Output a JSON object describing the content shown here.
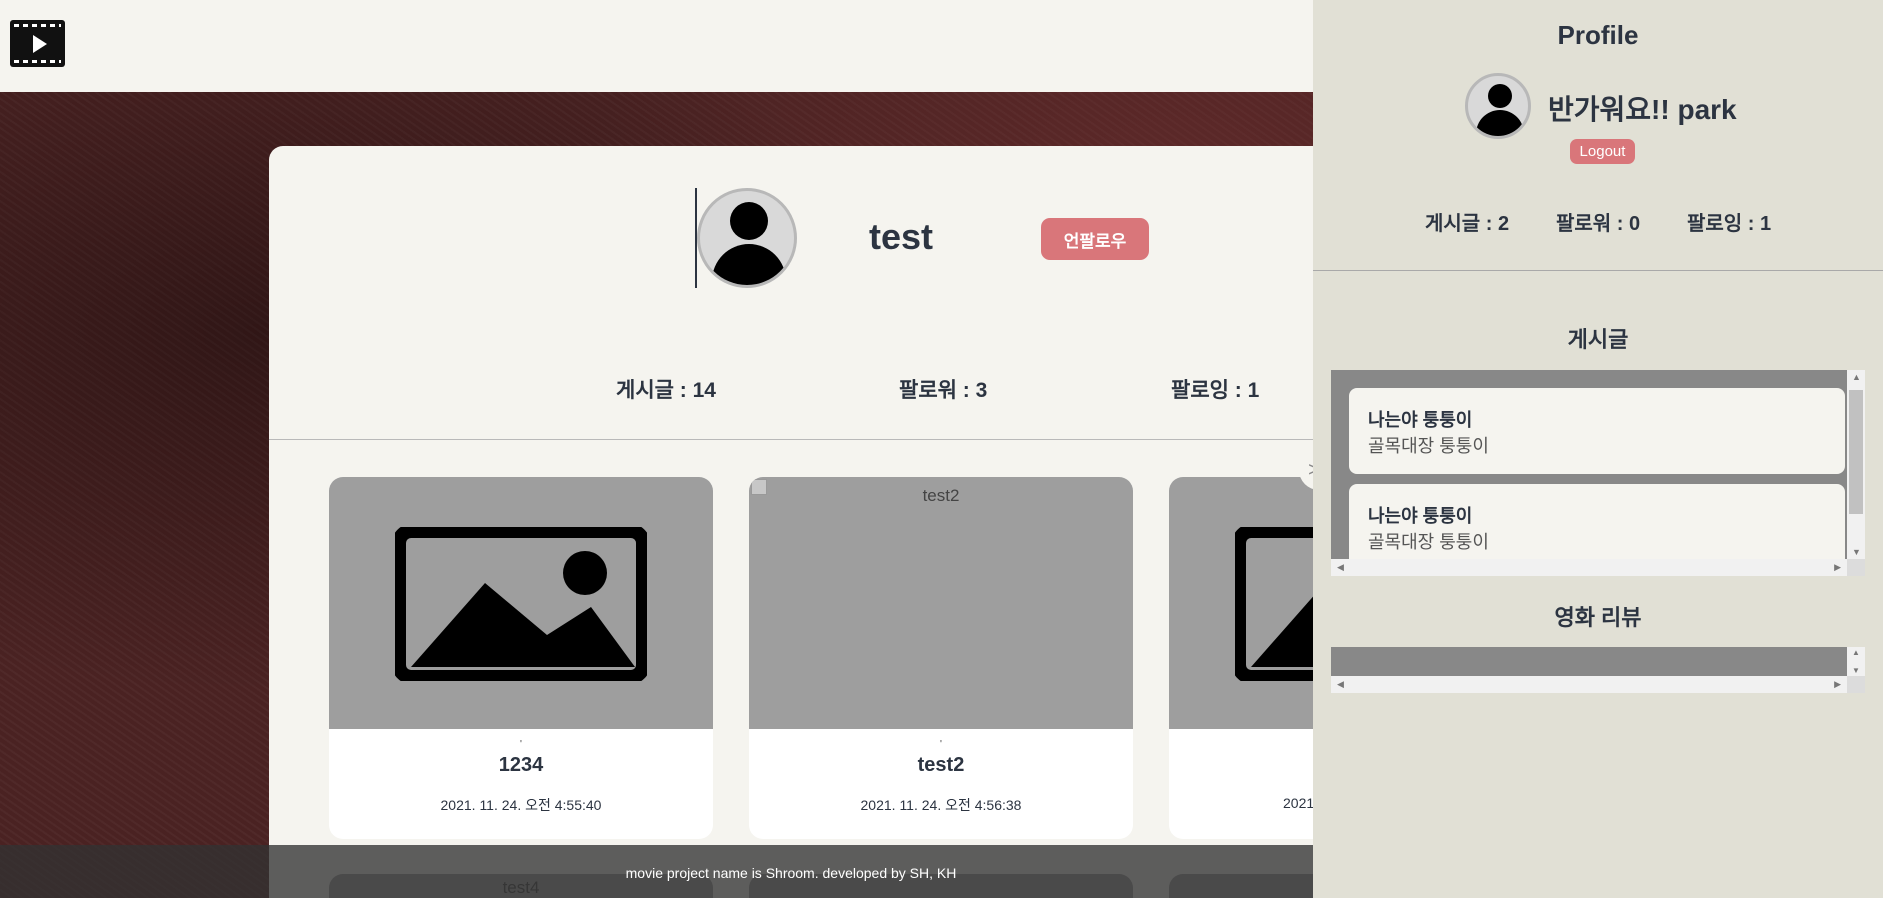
{
  "header": {
    "logo_icon": "film-play-icon"
  },
  "profile": {
    "username": "test",
    "unfollow_label": "언팔로우",
    "stats": {
      "posts": "게시글 : 14",
      "followers": "팔로워 : 3",
      "following": "팔로잉 : 1"
    }
  },
  "posts": [
    {
      "title": "1234",
      "date": "2021. 11. 24. 오전 4:55:40",
      "image_alt": "",
      "tick": "'"
    },
    {
      "title": "test2",
      "date": "2021. 11. 24. 오전 4:56:38",
      "image_alt": "test2",
      "tick": "'"
    },
    {
      "title": "",
      "date": "2021.",
      "image_alt": ""
    }
  ],
  "posts_row2": [
    {
      "image_alt": "test4"
    }
  ],
  "next_label": ">",
  "footer": {
    "text": "movie project name is Shroom. developed by SH, KH"
  },
  "panel": {
    "title": "Profile",
    "greeting": "반가워요!! park",
    "logout_label": "Logout",
    "stats": {
      "posts": "게시글 : 2",
      "followers": "팔로워 : 0",
      "following": "팔로잉 : 1"
    },
    "posts_title": "게시글",
    "post_items": [
      {
        "title": "나는야 퉁퉁이",
        "subtitle": "골목대장 퉁퉁이"
      },
      {
        "title": "나는야 퉁퉁이",
        "subtitle": "골목대장 퉁퉁이"
      }
    ],
    "reviews_title": "영화 리뷰"
  },
  "colors": {
    "accent_button": "#d9767a",
    "panel_bg": "#e1e0d5",
    "page_bg": "#f5f4ef",
    "text": "#2c3441"
  }
}
